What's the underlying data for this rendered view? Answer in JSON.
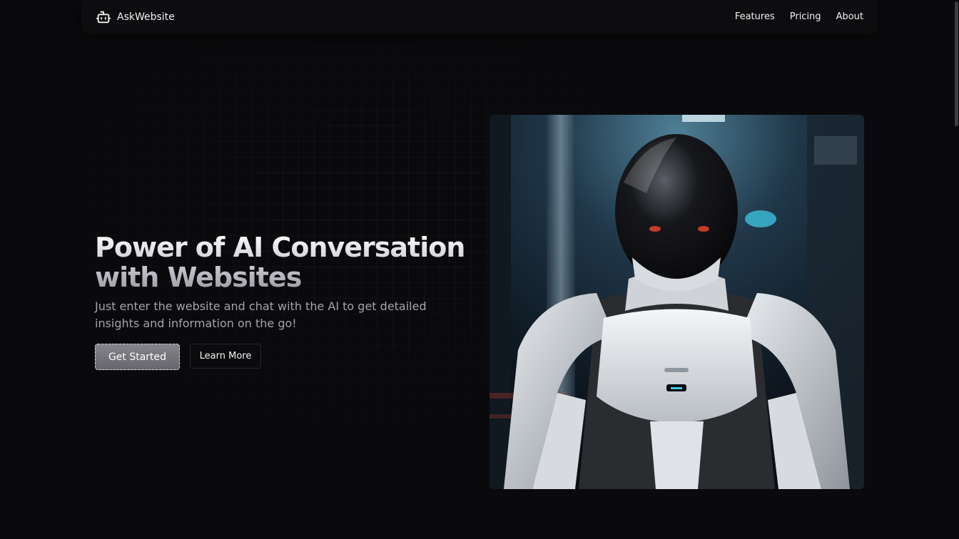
{
  "app": {
    "brand_name": "AskWebsite",
    "brand_icon": "robot-icon"
  },
  "nav": {
    "links": [
      {
        "label": "Features"
      },
      {
        "label": "Pricing"
      },
      {
        "label": "About"
      }
    ]
  },
  "hero": {
    "headline_line1": "Power of AI Conversation",
    "headline_line2": "with Websites",
    "subtitle": "Just enter the website and chat with the AI to get detailed insights and information on the go!",
    "primary_button": "Get Started",
    "secondary_button": "Learn More",
    "image_subject": "white armored robot with black helmet"
  },
  "colors": {
    "background": "#0a0a0c",
    "navbar": "#0d0d10",
    "subtitle_text": "#a4a3ad",
    "primary_button": "#77777e",
    "secondary_button_border": "#26262b"
  }
}
